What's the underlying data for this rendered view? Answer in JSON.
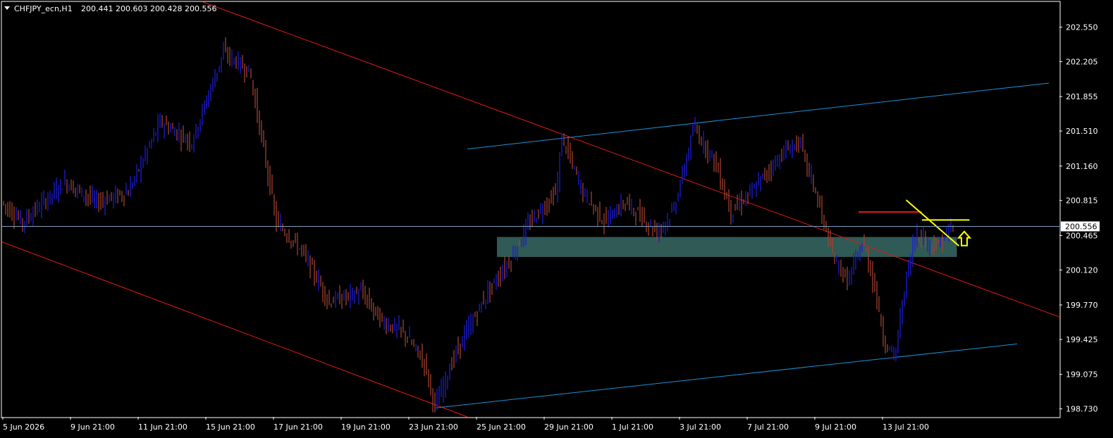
{
  "header": {
    "menu_icon": "triangle-down-icon",
    "symbol": "CHFJPY_ecn,H1",
    "ohlc": "200.441 200.603 200.428 200.556"
  },
  "colors": {
    "background": "#000000",
    "frame": "#ffffff",
    "bull_candle": "#1c1cd6",
    "bear_candle": "#a0412f",
    "channel_red": "#e01818",
    "channel_blue": "#1e90d8",
    "zone": "#2f5a55",
    "marker_yellow": "#ffff00",
    "bid_line": "#7f9fbf",
    "price_tag_bg": "#ffffff",
    "price_tag_text": "#000000"
  },
  "chart_data": {
    "type": "candlestick",
    "symbol": "CHFJPY_ecn",
    "timeframe": "H1",
    "ylim": [
      198.65,
      202.8
    ],
    "y_ticks": [
      "202.550",
      "202.205",
      "201.855",
      "201.510",
      "201.160",
      "200.815",
      "200.465",
      "200.120",
      "199.770",
      "199.425",
      "199.075",
      "198.730"
    ],
    "x_ticks": [
      "5 Jun 2026",
      "9 Jun 21:00",
      "11 Jun 21:00",
      "15 Jun 21:00",
      "17 Jun 21:00",
      "19 Jun 21:00",
      "23 Jun 21:00",
      "25 Jun 21:00",
      "29 Jun 21:00",
      "1 Jul 21:00",
      "3 Jul 21:00",
      "7 Jul 21:00",
      "9 Jul 21:00",
      "13 Jul 21:00"
    ],
    "current_price": "200.556",
    "price_path": [
      [
        0,
        200.8
      ],
      [
        0.02,
        200.6
      ],
      [
        0.06,
        201.0
      ],
      [
        0.09,
        200.8
      ],
      [
        0.12,
        200.9
      ],
      [
        0.15,
        201.6
      ],
      [
        0.18,
        201.4
      ],
      [
        0.21,
        202.3
      ],
      [
        0.235,
        202.1
      ],
      [
        0.26,
        200.6
      ],
      [
        0.285,
        200.3
      ],
      [
        0.31,
        199.8
      ],
      [
        0.34,
        199.9
      ],
      [
        0.36,
        199.6
      ],
      [
        0.38,
        199.5
      ],
      [
        0.4,
        199.2
      ],
      [
        0.41,
        198.75
      ],
      [
        0.43,
        199.3
      ],
      [
        0.46,
        199.9
      ],
      [
        0.48,
        200.2
      ],
      [
        0.5,
        200.6
      ],
      [
        0.525,
        200.9
      ],
      [
        0.53,
        201.45
      ],
      [
        0.55,
        200.9
      ],
      [
        0.57,
        200.6
      ],
      [
        0.59,
        200.8
      ],
      [
        0.62,
        200.5
      ],
      [
        0.635,
        200.7
      ],
      [
        0.645,
        201.1
      ],
      [
        0.655,
        201.55
      ],
      [
        0.675,
        201.2
      ],
      [
        0.69,
        200.7
      ],
      [
        0.71,
        200.9
      ],
      [
        0.72,
        201.05
      ],
      [
        0.74,
        201.3
      ],
      [
        0.755,
        201.4
      ],
      [
        0.77,
        200.9
      ],
      [
        0.785,
        200.3
      ],
      [
        0.8,
        200.0
      ],
      [
        0.815,
        200.4
      ],
      [
        0.825,
        200.0
      ],
      [
        0.835,
        199.4
      ],
      [
        0.845,
        199.25
      ],
      [
        0.855,
        200.0
      ],
      [
        0.865,
        200.5
      ],
      [
        0.875,
        200.4
      ],
      [
        0.885,
        200.35
      ],
      [
        0.895,
        200.5
      ],
      [
        0.9,
        200.556
      ]
    ],
    "annotations": {
      "red_channel_upper": [
        [
          0.19,
          202.8
        ],
        [
          1.0,
          199.65
        ]
      ],
      "red_channel_lower": [
        [
          0.0,
          200.4
        ],
        [
          0.44,
          198.65
        ]
      ],
      "blue_channel_upper": [
        [
          0.44,
          201.33
        ],
        [
          0.99,
          201.99
        ]
      ],
      "blue_channel_lower": [
        [
          0.41,
          198.74
        ],
        [
          0.96,
          199.38
        ]
      ],
      "support_zone": {
        "x": [
          0.468,
          0.903
        ],
        "y": [
          200.25,
          200.45
        ]
      },
      "red_level": {
        "x": [
          0.81,
          0.87
        ],
        "y": 200.7
      },
      "yellow_level": {
        "x": [
          0.87,
          0.915
        ],
        "y": 200.62
      },
      "yellow_trend": [
        [
          0.855,
          200.82
        ],
        [
          0.905,
          200.36
        ]
      ],
      "arrow": {
        "x": 0.91,
        "y": 200.42,
        "direction": "up"
      }
    }
  }
}
